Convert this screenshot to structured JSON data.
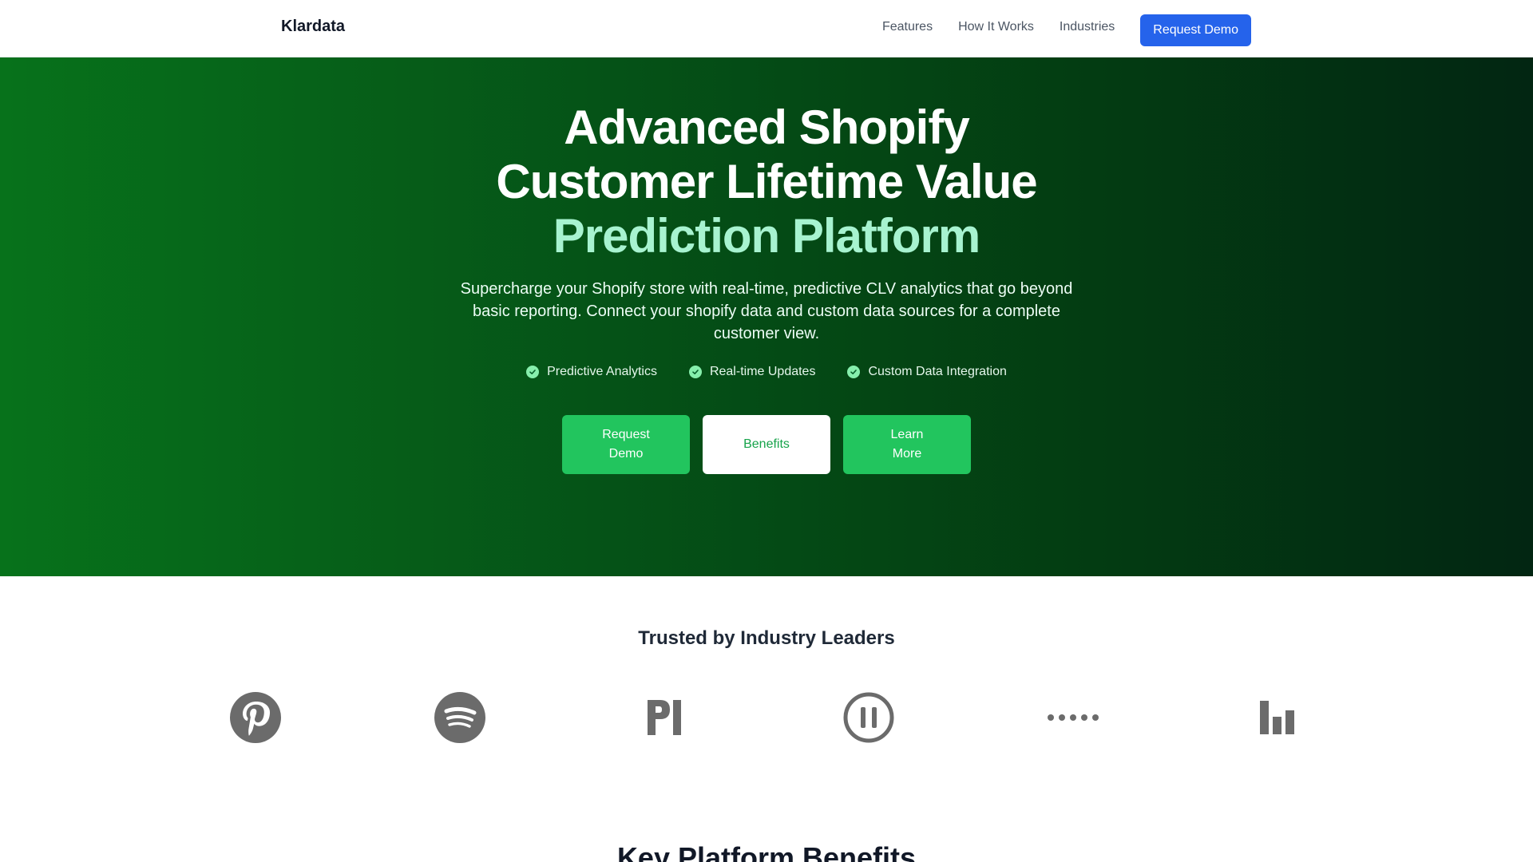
{
  "nav": {
    "brand": "Klardata",
    "links": [
      "Features",
      "How It Works",
      "Industries"
    ],
    "cta": "Request Demo"
  },
  "hero": {
    "title_line1": "Advanced Shopify",
    "title_line2": "Customer Lifetime Value",
    "title_line3": "Prediction Platform",
    "subtitle": "Supercharge your Shopify store with real-time, predictive CLV analytics that go beyond basic reporting. Connect your shopify data and custom data sources for a complete customer view.",
    "features": [
      "Predictive Analytics",
      "Real-time Updates",
      "Custom Data Integration"
    ],
    "buttons": {
      "request_demo": "Request Demo",
      "benefits": "Benefits",
      "learn_more": "Learn More"
    }
  },
  "trusted": {
    "title": "Trusted by Industry Leaders",
    "logos": [
      "pinterest-logo",
      "spotify-logo",
      "pi-logo",
      "pause-circle-logo",
      "dots-logo",
      "bar-chart-logo"
    ]
  },
  "next_section": {
    "title": "Key Platform Benefits"
  },
  "colors": {
    "accent_blue": "#2563eb",
    "green": "#22c55e",
    "hero_accent": "#a7f3d0",
    "logo_gray": "#6b6b6b"
  }
}
